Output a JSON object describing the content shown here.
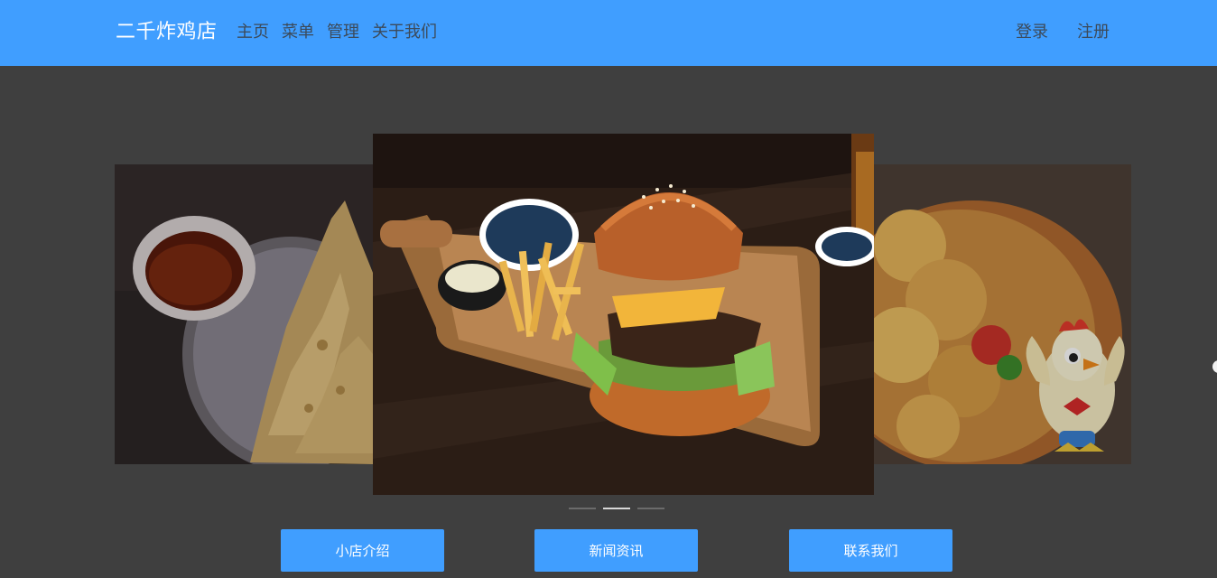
{
  "header": {
    "brand": "二千炸鸡店",
    "nav": [
      {
        "label": "主页"
      },
      {
        "label": "菜单"
      },
      {
        "label": "管理"
      },
      {
        "label": "关于我们"
      }
    ],
    "auth": {
      "login": "登录",
      "register": "注册"
    }
  },
  "carousel": {
    "slides": [
      {
        "image": "tempura-with-dipping-sauce"
      },
      {
        "image": "burger-and-fries-on-wooden-board"
      },
      {
        "image": "fried-chicken-with-chicken-mascot"
      }
    ],
    "active_index": 1,
    "indicator_count": 3
  },
  "actions": [
    {
      "label": "小店介绍"
    },
    {
      "label": "新闻资讯"
    },
    {
      "label": "联系我们"
    }
  ],
  "colors": {
    "accent": "#409eff",
    "background": "#3f3f3f"
  }
}
